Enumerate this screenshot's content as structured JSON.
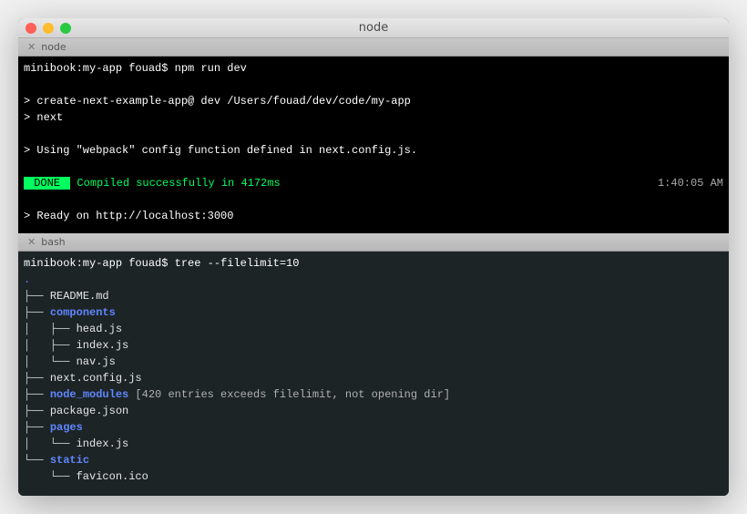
{
  "window": {
    "title": "node"
  },
  "tabs": {
    "top": "node",
    "bottom": "bash"
  },
  "paneTop": {
    "prompt": {
      "full": "minibook:my-app fouad$ ",
      "cmd": "npm run dev"
    },
    "lines": {
      "l1": "> create-next-example-app@ dev /Users/fouad/dev/code/my-app",
      "l2": "> next",
      "l3": "> Using \"webpack\" config function defined in next.config.js.",
      "doneLabel": " DONE ",
      "doneMsg": "Compiled successfully in 4172ms",
      "time": "1:40:05 AM",
      "ready": "> Ready on http://localhost:3000"
    }
  },
  "paneBottom": {
    "prompt": {
      "full": "minibook:my-app fouad$ ",
      "cmd": "tree --filelimit=10"
    },
    "tree": {
      "dot": ".",
      "l1a": "├── ",
      "l1b": "README.md",
      "l2a": "├── ",
      "l2b": "components",
      "l3a": "│   ├── ",
      "l3b": "head.js",
      "l4a": "│   ├── ",
      "l4b": "index.js",
      "l5a": "│   └── ",
      "l5b": "nav.js",
      "l6a": "├── ",
      "l6b": "next.config.js",
      "l7a": "├── ",
      "l7b": "node_modules",
      "l7c": " [420 entries exceeds filelimit, not opening dir]",
      "l8a": "├── ",
      "l8b": "package.json",
      "l9a": "├── ",
      "l9b": "pages",
      "l10a": "│   └── ",
      "l10b": "index.js",
      "l11a": "└── ",
      "l11b": "static",
      "l12a": "    └── ",
      "l12b": "favicon.ico"
    }
  }
}
